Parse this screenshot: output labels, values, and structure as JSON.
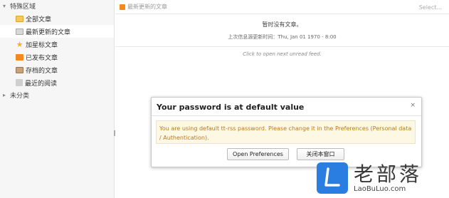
{
  "sidebar": {
    "special_category": "特殊区域",
    "feeds": [
      {
        "label": "全部文章",
        "icon": "folder-icon"
      },
      {
        "label": "最新更新的文章",
        "icon": "fresh-icon"
      },
      {
        "label": "加星标文章",
        "icon": "star-icon"
      },
      {
        "label": "已发布文章",
        "icon": "rss-icon"
      },
      {
        "label": "存档的文章",
        "icon": "archive-icon"
      },
      {
        "label": "最近的阅读",
        "icon": "recent-icon"
      }
    ],
    "uncategorized": "未分类"
  },
  "main": {
    "toolbar_title": "最新更新的文章",
    "select_label": "Select...",
    "no_articles": "暂时没有文章。",
    "last_update": "上次信息源更新时间：Thu, Jan 01 1970 - 8:00",
    "unread_hint": "Click to open next unread feed."
  },
  "dialog": {
    "title": "Your password is at default value",
    "close_glyph": "×",
    "message": "You are using default tt-rss password. Please change it in the Preferences (Personal data / Authentication).",
    "open_prefs_label": "Open Preferences",
    "close_label": "关闭本窗口"
  },
  "watermark": {
    "name": "老部落",
    "url": "LaoBuLuo.com"
  },
  "colors": {
    "accent": "#2a7de1",
    "warning_bg": "#fcf8e3",
    "warning_text": "#b47b25",
    "rss": "#f08a24"
  }
}
